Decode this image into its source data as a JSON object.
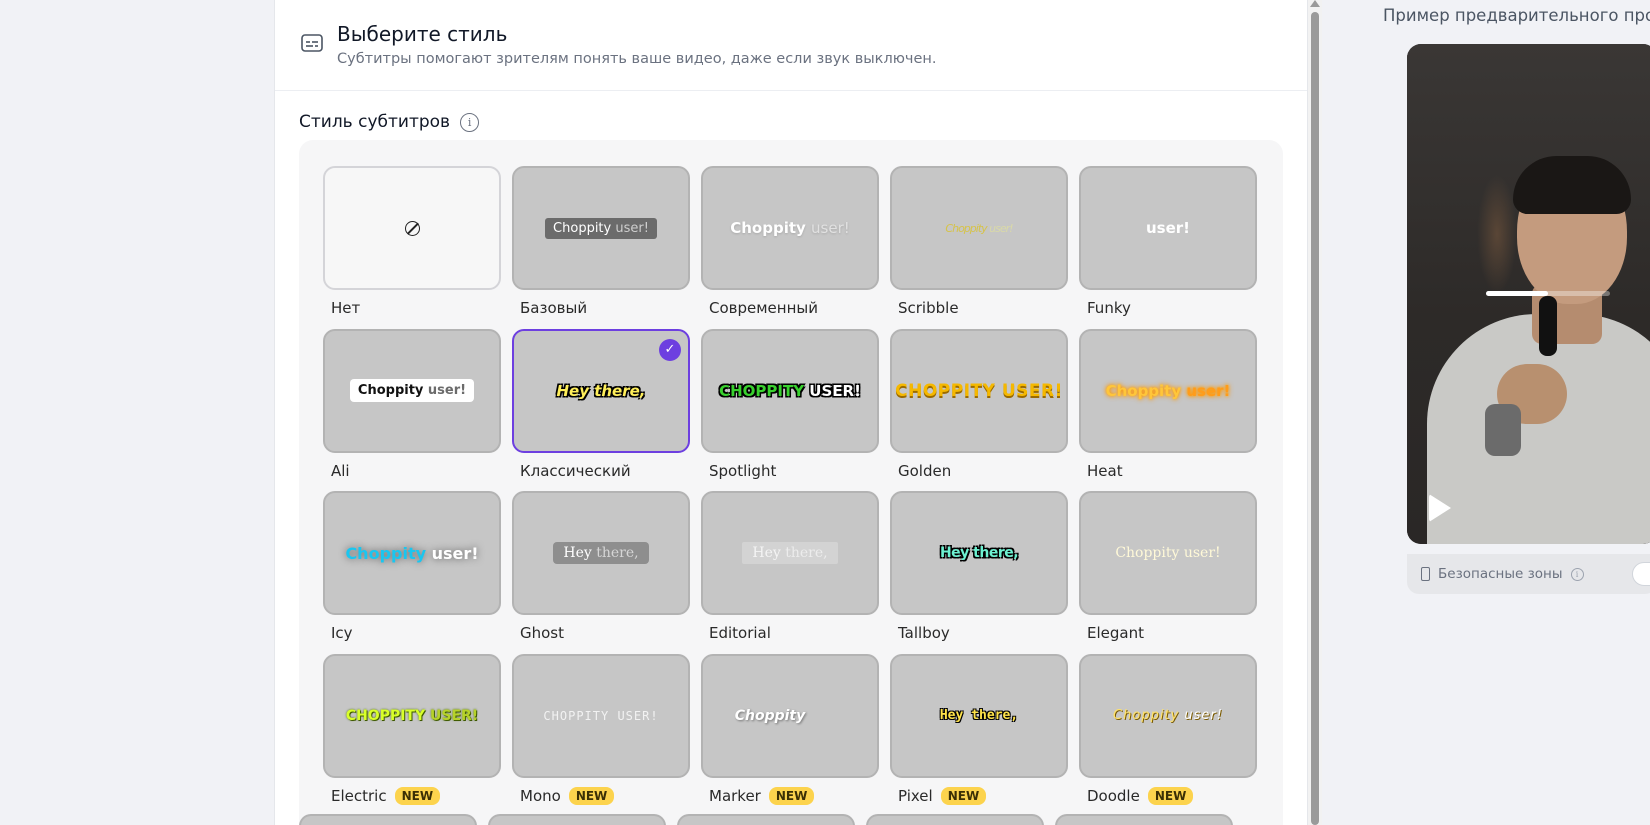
{
  "header": {
    "title": "Выберите стиль",
    "subtitle": "Субтитры помогают зрителям понять ваше видео, даже если звук выключен."
  },
  "section": {
    "label": "Стиль субтитров",
    "info_glyph": "i"
  },
  "styles": [
    {
      "name": "Нет",
      "sample_a": "",
      "sample_b": "",
      "new": false
    },
    {
      "name": "Базовый",
      "sample_a": "Choppity",
      "sample_b": "user!",
      "new": false
    },
    {
      "name": "Современный",
      "sample_a": "Choppity",
      "sample_b": "user!",
      "new": false
    },
    {
      "name": "Scribble",
      "sample_a": "Choppity",
      "sample_b": "user!",
      "new": false
    },
    {
      "name": "Funky",
      "sample_a": "user!",
      "sample_b": "",
      "new": false
    },
    {
      "name": "Ali",
      "sample_a": "Choppity",
      "sample_b": "user!",
      "new": false
    },
    {
      "name": "Классический",
      "sample_a": "Hey there,",
      "sample_b": "",
      "new": false,
      "selected": true
    },
    {
      "name": "Spotlight",
      "sample_a": "CHOPPITY",
      "sample_b": "USER!",
      "new": false
    },
    {
      "name": "Golden",
      "sample_a": "CHOPPITY USER!",
      "sample_b": "",
      "new": false
    },
    {
      "name": "Heat",
      "sample_a": "Choppity",
      "sample_b": "user!",
      "new": false
    },
    {
      "name": "Icy",
      "sample_a": "Choppity",
      "sample_b": "user!",
      "new": false
    },
    {
      "name": "Ghost",
      "sample_a": "Hey",
      "sample_b": "there,",
      "new": false
    },
    {
      "name": "Editorial",
      "sample_a": "Hey",
      "sample_b": "there,",
      "new": false
    },
    {
      "name": "Tallboy",
      "sample_a": "Hey there,",
      "sample_b": "",
      "new": false
    },
    {
      "name": "Elegant",
      "sample_a": "Choppity",
      "sample_b": "user!",
      "new": false
    },
    {
      "name": "Electric",
      "sample_a": "CHOPPITY",
      "sample_b": "USER!",
      "new": true
    },
    {
      "name": "Mono",
      "sample_a": "CHOPPITY USER!",
      "sample_b": "",
      "new": true
    },
    {
      "name": "Marker",
      "sample_a": "Choppity",
      "sample_b": "",
      "new": true
    },
    {
      "name": "Pixel",
      "sample_a": "Hey there,",
      "sample_b": "",
      "new": true
    },
    {
      "name": "Doodle",
      "sample_a": "Choppity",
      "sample_b": "user!",
      "new": true
    }
  ],
  "badge_label": "NEW",
  "check_glyph": "✓",
  "preview": {
    "label": "Пример предварительного прос",
    "safe_zones_label": "Безопасные зоны",
    "info_glyph": "i",
    "caption_progress": 0.5
  },
  "colors": {
    "accent": "#6d3fe0",
    "badge": "#fcd34d",
    "tile_bg": "#c6c6c6"
  }
}
